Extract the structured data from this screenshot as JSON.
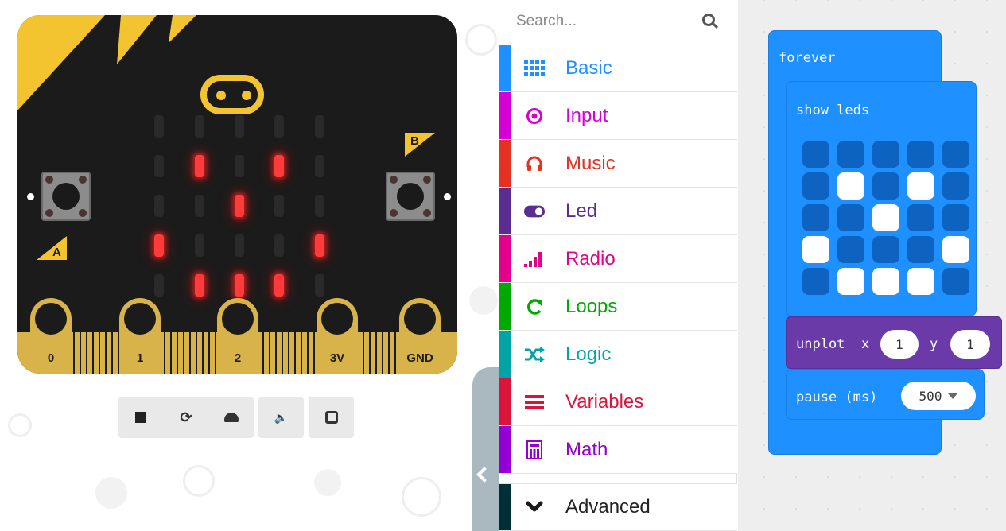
{
  "simulator": {
    "button_a": "A",
    "button_b": "B",
    "pins": [
      "0",
      "1",
      "2",
      "3V",
      "GND"
    ],
    "led_matrix": [
      [
        0,
        0,
        0,
        0,
        0
      ],
      [
        0,
        1,
        0,
        1,
        0
      ],
      [
        0,
        0,
        1,
        0,
        0
      ],
      [
        1,
        0,
        0,
        0,
        1
      ],
      [
        0,
        1,
        1,
        1,
        0
      ]
    ],
    "toolbar_icons": [
      "stop-icon",
      "restart-icon",
      "slow-motion-icon",
      "mute-icon",
      "fullscreen-icon"
    ]
  },
  "toolbox": {
    "search_placeholder": "Search...",
    "categories": [
      {
        "label": "Basic",
        "color": "#1e90ff",
        "icon": "grid-icon"
      },
      {
        "label": "Input",
        "color": "#d400d4",
        "icon": "target-icon"
      },
      {
        "label": "Music",
        "color": "#e63022",
        "icon": "headphones-icon"
      },
      {
        "label": "Led",
        "color": "#5c2d91",
        "icon": "toggle-icon"
      },
      {
        "label": "Radio",
        "color": "#e3008c",
        "icon": "signal-bars-icon"
      },
      {
        "label": "Loops",
        "color": "#00aa00",
        "icon": "refresh-icon"
      },
      {
        "label": "Logic",
        "color": "#00a4a6",
        "icon": "shuffle-icon"
      },
      {
        "label": "Variables",
        "color": "#dc143c",
        "icon": "list-lines-icon"
      },
      {
        "label": "Math",
        "color": "#9400d3",
        "icon": "calculator-icon"
      }
    ],
    "advanced": {
      "label": "Advanced",
      "color": "#002f36"
    }
  },
  "workspace": {
    "forever_label": "forever",
    "show_leds_label": "show leds",
    "show_leds_grid": [
      [
        0,
        0,
        0,
        0,
        0
      ],
      [
        0,
        1,
        0,
        1,
        0
      ],
      [
        0,
        0,
        1,
        0,
        0
      ],
      [
        1,
        0,
        0,
        0,
        1
      ],
      [
        0,
        1,
        1,
        1,
        0
      ]
    ],
    "unplot": {
      "label": "unplot",
      "x_label": "x",
      "x_value": "1",
      "y_label": "y",
      "y_value": "1"
    },
    "pause": {
      "label": "pause (ms)",
      "value": "500"
    }
  }
}
